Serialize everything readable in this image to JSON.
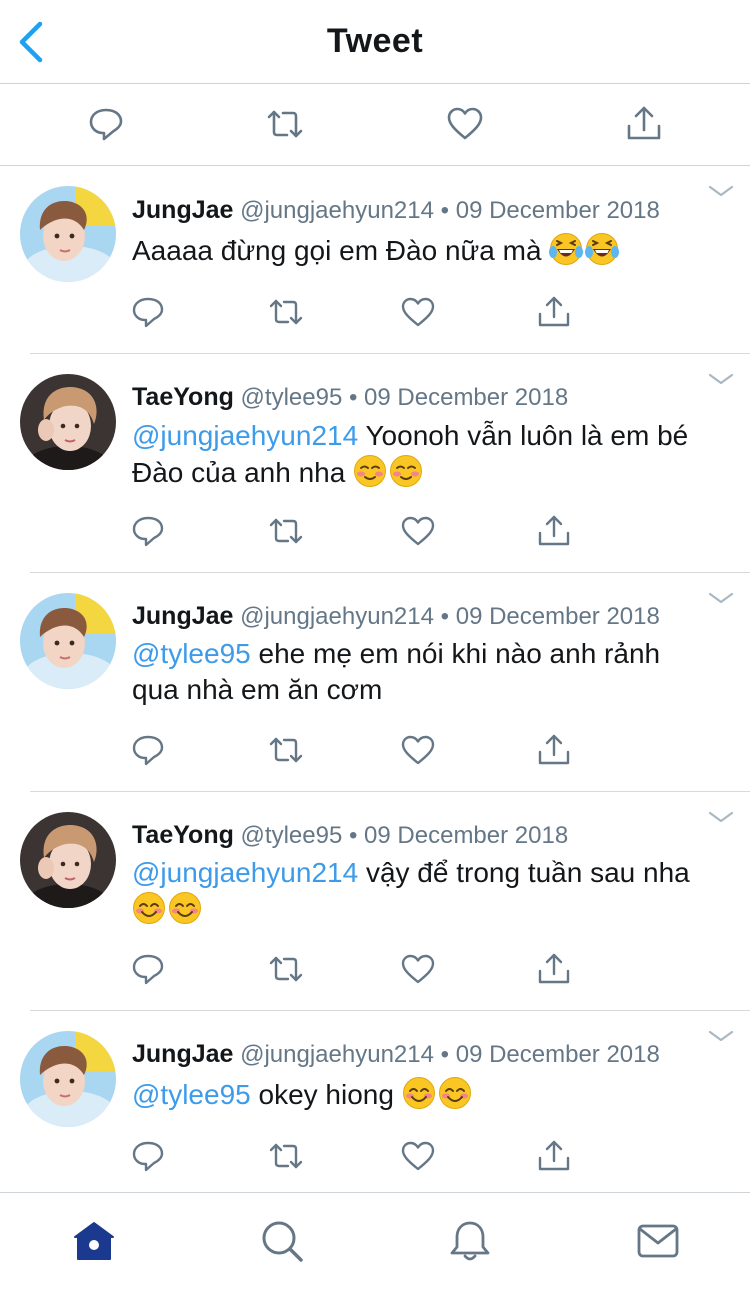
{
  "header": {
    "title": "Tweet"
  },
  "colors": {
    "accent": "#1da1f2",
    "mention": "#3d9be9",
    "text": "#14171a",
    "secondary": "#657786",
    "nav_active": "#1b3a8f"
  },
  "action_bar": [
    "reply-icon",
    "retweet-icon",
    "like-icon",
    "share-icon"
  ],
  "tweets": [
    {
      "name": "JungJae",
      "handle": "@jungjaehyun214",
      "sep": "•",
      "date": "09 December 2018",
      "mention": "",
      "text": "Aaaaa đừng gọi em Đào nữa mà",
      "emoji": [
        "laughing-tears-emoji",
        "laughing-tears-emoji"
      ]
    },
    {
      "name": "TaeYong",
      "handle": "@tylee95",
      "sep": "•",
      "date": "09 December 2018",
      "mention": "@jungjaehyun214",
      "text": " Yoonoh vẫn luôn là em bé Đào của anh nha",
      "emoji": [
        "relieved-blush-emoji",
        "relieved-blush-emoji"
      ]
    },
    {
      "name": "JungJae",
      "handle": "@jungjaehyun214",
      "sep": "•",
      "date": "09 December 2018",
      "mention": "@tylee95",
      "text": " ehe mẹ em nói khi nào anh rảnh qua nhà em ăn cơm",
      "emoji": []
    },
    {
      "name": "TaeYong",
      "handle": "@tylee95",
      "sep": "•",
      "date": "09 December 2018",
      "mention": "@jungjaehyun214",
      "text": " vậy để trong tuần sau nha",
      "emoji": [
        "smiling-blush-emoji",
        "smiling-blush-emoji"
      ]
    },
    {
      "name": "JungJae",
      "handle": "@jungjaehyun214",
      "sep": "•",
      "date": "09 December 2018",
      "mention": "@tylee95",
      "text": " okey hiong",
      "emoji": [
        "smiling-blush-emoji",
        "smiling-blush-emoji"
      ]
    }
  ],
  "tabbar": [
    "home-icon",
    "search-icon",
    "notifications-icon",
    "messages-icon"
  ]
}
